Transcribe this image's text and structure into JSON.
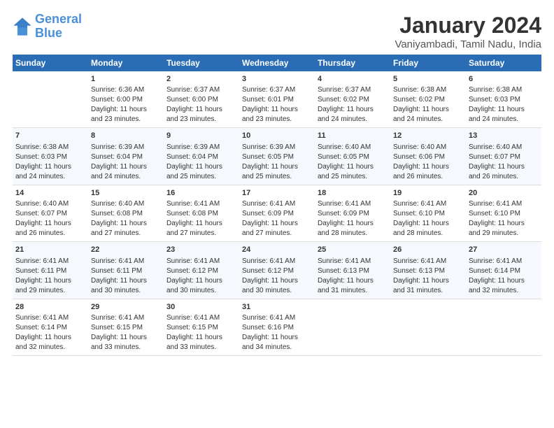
{
  "header": {
    "logo_line1": "General",
    "logo_line2": "Blue",
    "title": "January 2024",
    "subtitle": "Vaniyambadi, Tamil Nadu, India"
  },
  "days_of_week": [
    "Sunday",
    "Monday",
    "Tuesday",
    "Wednesday",
    "Thursday",
    "Friday",
    "Saturday"
  ],
  "weeks": [
    [
      {
        "day": "",
        "sunrise": "",
        "sunset": "",
        "daylight": ""
      },
      {
        "day": "1",
        "sunrise": "Sunrise: 6:36 AM",
        "sunset": "Sunset: 6:00 PM",
        "daylight": "Daylight: 11 hours and 23 minutes."
      },
      {
        "day": "2",
        "sunrise": "Sunrise: 6:37 AM",
        "sunset": "Sunset: 6:00 PM",
        "daylight": "Daylight: 11 hours and 23 minutes."
      },
      {
        "day": "3",
        "sunrise": "Sunrise: 6:37 AM",
        "sunset": "Sunset: 6:01 PM",
        "daylight": "Daylight: 11 hours and 23 minutes."
      },
      {
        "day": "4",
        "sunrise": "Sunrise: 6:37 AM",
        "sunset": "Sunset: 6:02 PM",
        "daylight": "Daylight: 11 hours and 24 minutes."
      },
      {
        "day": "5",
        "sunrise": "Sunrise: 6:38 AM",
        "sunset": "Sunset: 6:02 PM",
        "daylight": "Daylight: 11 hours and 24 minutes."
      },
      {
        "day": "6",
        "sunrise": "Sunrise: 6:38 AM",
        "sunset": "Sunset: 6:03 PM",
        "daylight": "Daylight: 11 hours and 24 minutes."
      }
    ],
    [
      {
        "day": "7",
        "sunrise": "Sunrise: 6:38 AM",
        "sunset": "Sunset: 6:03 PM",
        "daylight": "Daylight: 11 hours and 24 minutes."
      },
      {
        "day": "8",
        "sunrise": "Sunrise: 6:39 AM",
        "sunset": "Sunset: 6:04 PM",
        "daylight": "Daylight: 11 hours and 24 minutes."
      },
      {
        "day": "9",
        "sunrise": "Sunrise: 6:39 AM",
        "sunset": "Sunset: 6:04 PM",
        "daylight": "Daylight: 11 hours and 25 minutes."
      },
      {
        "day": "10",
        "sunrise": "Sunrise: 6:39 AM",
        "sunset": "Sunset: 6:05 PM",
        "daylight": "Daylight: 11 hours and 25 minutes."
      },
      {
        "day": "11",
        "sunrise": "Sunrise: 6:40 AM",
        "sunset": "Sunset: 6:05 PM",
        "daylight": "Daylight: 11 hours and 25 minutes."
      },
      {
        "day": "12",
        "sunrise": "Sunrise: 6:40 AM",
        "sunset": "Sunset: 6:06 PM",
        "daylight": "Daylight: 11 hours and 26 minutes."
      },
      {
        "day": "13",
        "sunrise": "Sunrise: 6:40 AM",
        "sunset": "Sunset: 6:07 PM",
        "daylight": "Daylight: 11 hours and 26 minutes."
      }
    ],
    [
      {
        "day": "14",
        "sunrise": "Sunrise: 6:40 AM",
        "sunset": "Sunset: 6:07 PM",
        "daylight": "Daylight: 11 hours and 26 minutes."
      },
      {
        "day": "15",
        "sunrise": "Sunrise: 6:40 AM",
        "sunset": "Sunset: 6:08 PM",
        "daylight": "Daylight: 11 hours and 27 minutes."
      },
      {
        "day": "16",
        "sunrise": "Sunrise: 6:41 AM",
        "sunset": "Sunset: 6:08 PM",
        "daylight": "Daylight: 11 hours and 27 minutes."
      },
      {
        "day": "17",
        "sunrise": "Sunrise: 6:41 AM",
        "sunset": "Sunset: 6:09 PM",
        "daylight": "Daylight: 11 hours and 27 minutes."
      },
      {
        "day": "18",
        "sunrise": "Sunrise: 6:41 AM",
        "sunset": "Sunset: 6:09 PM",
        "daylight": "Daylight: 11 hours and 28 minutes."
      },
      {
        "day": "19",
        "sunrise": "Sunrise: 6:41 AM",
        "sunset": "Sunset: 6:10 PM",
        "daylight": "Daylight: 11 hours and 28 minutes."
      },
      {
        "day": "20",
        "sunrise": "Sunrise: 6:41 AM",
        "sunset": "Sunset: 6:10 PM",
        "daylight": "Daylight: 11 hours and 29 minutes."
      }
    ],
    [
      {
        "day": "21",
        "sunrise": "Sunrise: 6:41 AM",
        "sunset": "Sunset: 6:11 PM",
        "daylight": "Daylight: 11 hours and 29 minutes."
      },
      {
        "day": "22",
        "sunrise": "Sunrise: 6:41 AM",
        "sunset": "Sunset: 6:11 PM",
        "daylight": "Daylight: 11 hours and 30 minutes."
      },
      {
        "day": "23",
        "sunrise": "Sunrise: 6:41 AM",
        "sunset": "Sunset: 6:12 PM",
        "daylight": "Daylight: 11 hours and 30 minutes."
      },
      {
        "day": "24",
        "sunrise": "Sunrise: 6:41 AM",
        "sunset": "Sunset: 6:12 PM",
        "daylight": "Daylight: 11 hours and 30 minutes."
      },
      {
        "day": "25",
        "sunrise": "Sunrise: 6:41 AM",
        "sunset": "Sunset: 6:13 PM",
        "daylight": "Daylight: 11 hours and 31 minutes."
      },
      {
        "day": "26",
        "sunrise": "Sunrise: 6:41 AM",
        "sunset": "Sunset: 6:13 PM",
        "daylight": "Daylight: 11 hours and 31 minutes."
      },
      {
        "day": "27",
        "sunrise": "Sunrise: 6:41 AM",
        "sunset": "Sunset: 6:14 PM",
        "daylight": "Daylight: 11 hours and 32 minutes."
      }
    ],
    [
      {
        "day": "28",
        "sunrise": "Sunrise: 6:41 AM",
        "sunset": "Sunset: 6:14 PM",
        "daylight": "Daylight: 11 hours and 32 minutes."
      },
      {
        "day": "29",
        "sunrise": "Sunrise: 6:41 AM",
        "sunset": "Sunset: 6:15 PM",
        "daylight": "Daylight: 11 hours and 33 minutes."
      },
      {
        "day": "30",
        "sunrise": "Sunrise: 6:41 AM",
        "sunset": "Sunset: 6:15 PM",
        "daylight": "Daylight: 11 hours and 33 minutes."
      },
      {
        "day": "31",
        "sunrise": "Sunrise: 6:41 AM",
        "sunset": "Sunset: 6:16 PM",
        "daylight": "Daylight: 11 hours and 34 minutes."
      },
      {
        "day": "",
        "sunrise": "",
        "sunset": "",
        "daylight": ""
      },
      {
        "day": "",
        "sunrise": "",
        "sunset": "",
        "daylight": ""
      },
      {
        "day": "",
        "sunrise": "",
        "sunset": "",
        "daylight": ""
      }
    ]
  ]
}
